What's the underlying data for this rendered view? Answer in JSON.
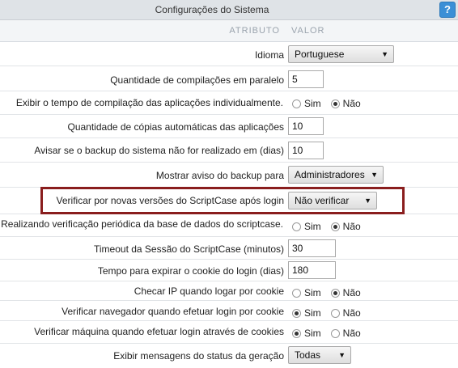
{
  "header": {
    "title": "Configurações do Sistema",
    "help_label": "?",
    "col_attr": "ATRIBUTO",
    "col_value": "VALOR"
  },
  "rows": {
    "idioma": {
      "label": "Idioma",
      "value": "Portuguese"
    },
    "compilacoes": {
      "label": "Quantidade de compilações em paralelo",
      "value": "5"
    },
    "tempo_compilacao": {
      "label": "Exibir o tempo de compilação das aplicações individualmente.",
      "opt_sim": "Sim",
      "opt_nao": "Não",
      "selected": "Não"
    },
    "copias": {
      "label": "Quantidade de cópias automáticas das aplicações",
      "value": "10"
    },
    "aviso_backup_dias": {
      "label": "Avisar se o backup do sistema não for realizado em (dias)",
      "value": "10"
    },
    "mostrar_aviso_backup": {
      "label": "Mostrar aviso do backup para",
      "value": "Administradores"
    },
    "verificar_versoes": {
      "label": "Verificar por novas versões do ScriptCase após login",
      "value": "Não verificar"
    },
    "verificacao_periodica": {
      "label": "Realizando verificação periódica da base de dados do scriptcase.",
      "opt_sim": "Sim",
      "opt_nao": "Não",
      "selected": "Não"
    },
    "timeout": {
      "label": "Timeout da Sessão do ScriptCase (minutos)",
      "value": "30"
    },
    "cookie_login": {
      "label": "Tempo para expirar o cookie do login (dias)",
      "value": "180"
    },
    "checar_ip": {
      "label": "Checar IP quando logar por cookie",
      "opt_sim": "Sim",
      "opt_nao": "Não",
      "selected": "Não"
    },
    "verificar_navegador": {
      "label": "Verificar navegador quando efetuar login por cookie",
      "opt_sim": "Sim",
      "opt_nao": "Não",
      "selected": "Sim"
    },
    "verificar_maquina": {
      "label": "Verificar máquina quando efetuar login através de cookies",
      "opt_sim": "Sim",
      "opt_nao": "Não",
      "selected": "Sim"
    },
    "status_geracao": {
      "label": "Exibir mensagens do status da geração",
      "value": "Todas"
    }
  },
  "colors": {
    "highlight_border": "#8a1e1e",
    "help_button": "#3b8fd6"
  }
}
